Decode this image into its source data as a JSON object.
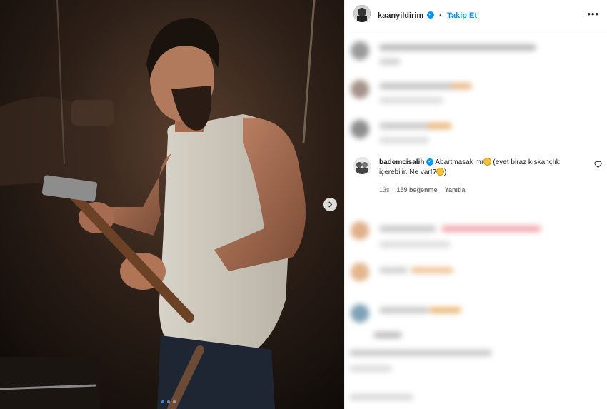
{
  "post": {
    "author": "kaanyildirim",
    "follow_label": "Takip Et",
    "separator": "•",
    "more_label": "•••"
  },
  "media": {
    "slides_total": 3,
    "active_slide": 1
  },
  "highlight_comment": {
    "username": "bademcisalih",
    "text_part1": "Abartmasak mı",
    "text_part2": " (evet biraz kıskançlık içerebilir. Ne var!?",
    "text_part3": ")",
    "time": "13s",
    "likes": "159 beğenme",
    "reply_label": "Yanıtla"
  },
  "colors": {
    "accent": "#0095f6",
    "text": "#262626",
    "muted": "#737373"
  },
  "icons": [
    "verified-badge-icon",
    "more-options-icon",
    "next-arrow-icon",
    "heart-icon",
    "emoji-icon"
  ]
}
